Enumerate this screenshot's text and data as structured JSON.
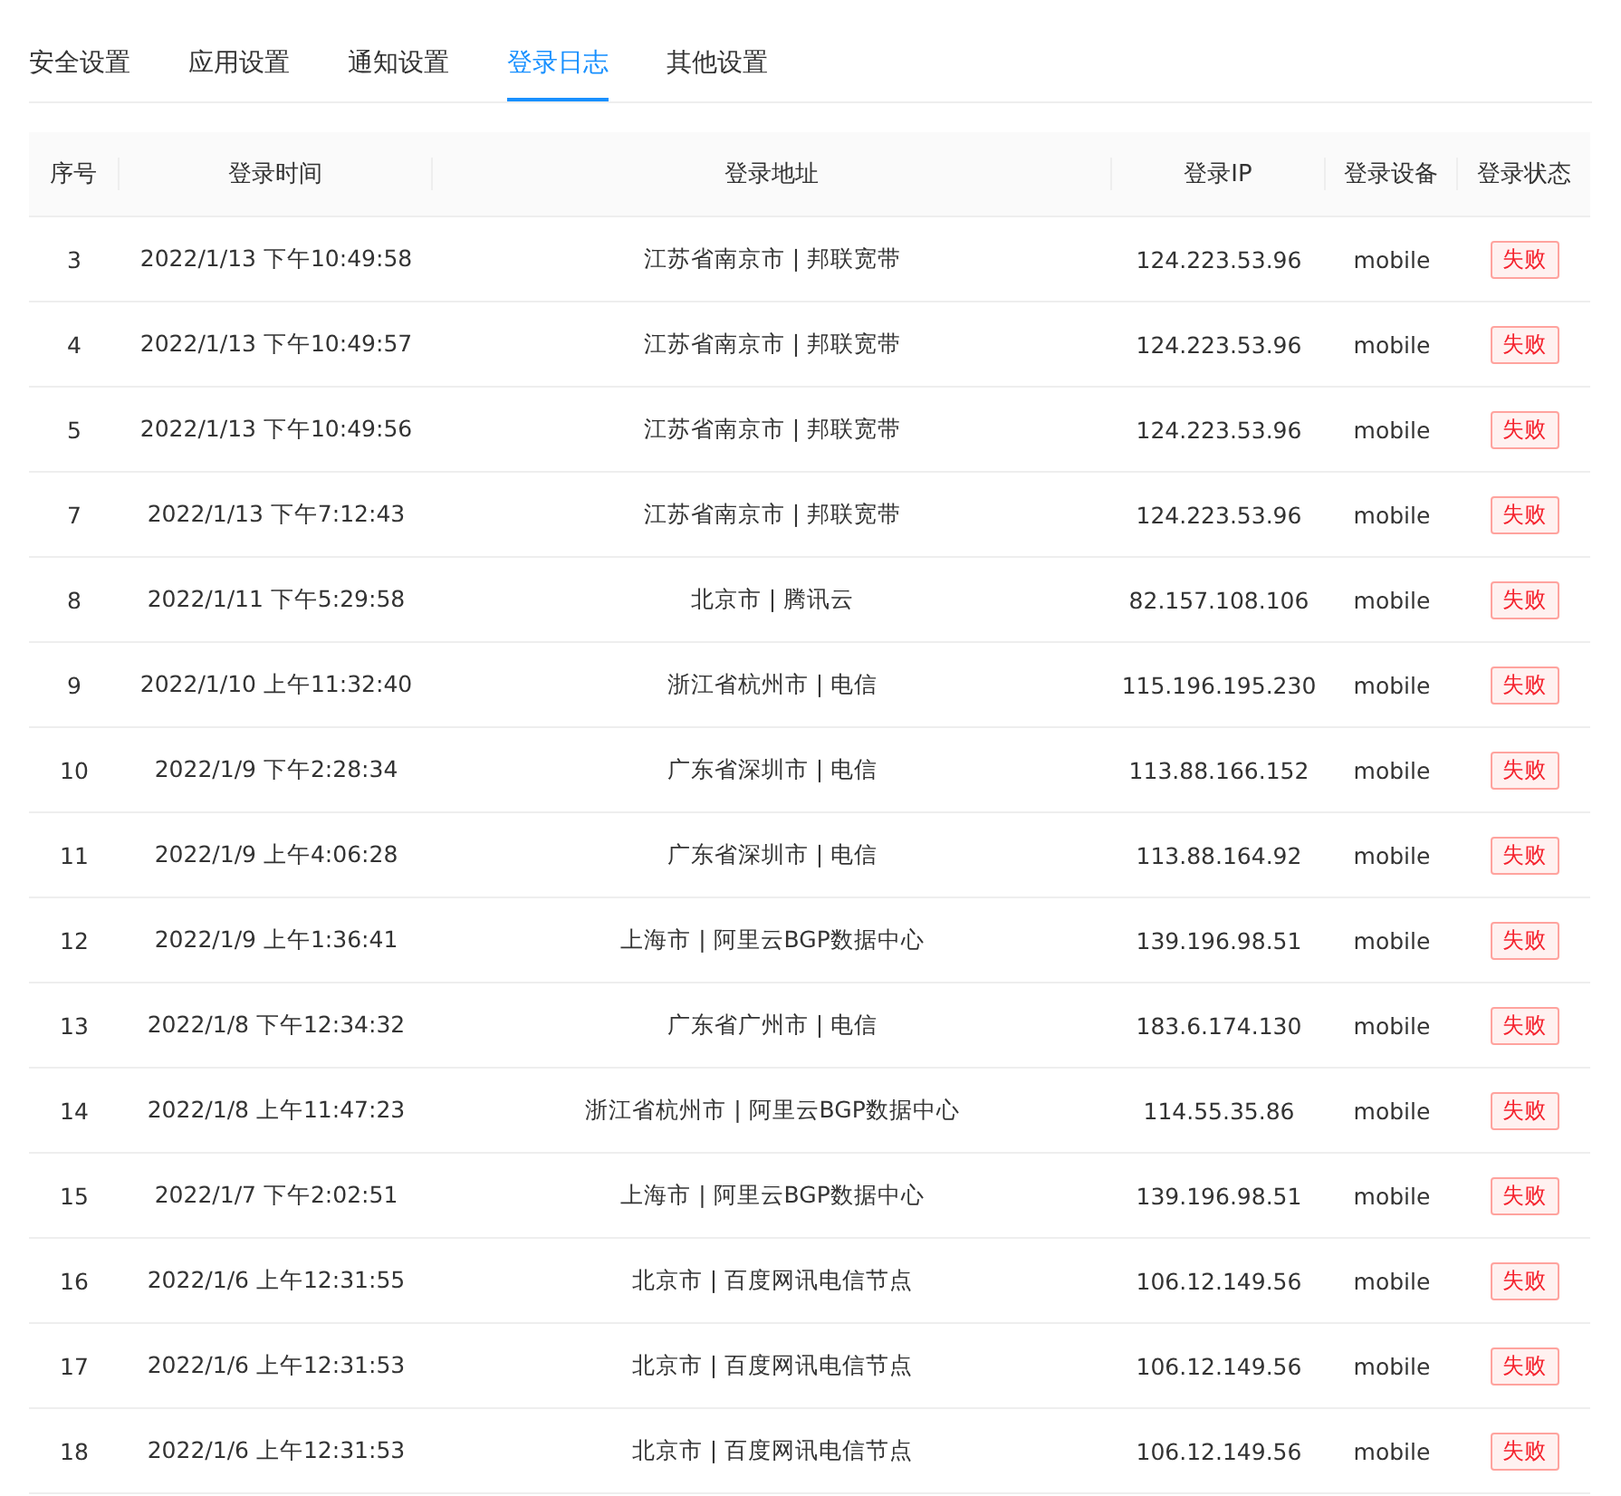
{
  "tabs": [
    {
      "label": "安全设置",
      "selected": false
    },
    {
      "label": "应用设置",
      "selected": false
    },
    {
      "label": "通知设置",
      "selected": false
    },
    {
      "label": "登录日志",
      "selected": true
    },
    {
      "label": "其他设置",
      "selected": false
    }
  ],
  "table": {
    "columns": [
      "序号",
      "登录时间",
      "登录地址",
      "登录IP",
      "登录设备",
      "登录状态"
    ],
    "rows": [
      {
        "index": "3",
        "time": "2022/1/13 下午10:49:58",
        "address": "江苏省南京市 | 邦联宽带",
        "ip": "124.223.53.96",
        "device": "mobile",
        "status": {
          "text": "失败",
          "kind": "error"
        }
      },
      {
        "index": "4",
        "time": "2022/1/13 下午10:49:57",
        "address": "江苏省南京市 | 邦联宽带",
        "ip": "124.223.53.96",
        "device": "mobile",
        "status": {
          "text": "失败",
          "kind": "error"
        }
      },
      {
        "index": "5",
        "time": "2022/1/13 下午10:49:56",
        "address": "江苏省南京市 | 邦联宽带",
        "ip": "124.223.53.96",
        "device": "mobile",
        "status": {
          "text": "失败",
          "kind": "error"
        }
      },
      {
        "index": "7",
        "time": "2022/1/13 下午7:12:43",
        "address": "江苏省南京市 | 邦联宽带",
        "ip": "124.223.53.96",
        "device": "mobile",
        "status": {
          "text": "失败",
          "kind": "error"
        }
      },
      {
        "index": "8",
        "time": "2022/1/11 下午5:29:58",
        "address": "北京市 | 腾讯云",
        "ip": "82.157.108.106",
        "device": "mobile",
        "status": {
          "text": "失败",
          "kind": "error"
        }
      },
      {
        "index": "9",
        "time": "2022/1/10 上午11:32:40",
        "address": "浙江省杭州市 | 电信",
        "ip": "115.196.195.230",
        "device": "mobile",
        "status": {
          "text": "失败",
          "kind": "error"
        }
      },
      {
        "index": "10",
        "time": "2022/1/9 下午2:28:34",
        "address": "广东省深圳市 | 电信",
        "ip": "113.88.166.152",
        "device": "mobile",
        "status": {
          "text": "失败",
          "kind": "error"
        }
      },
      {
        "index": "11",
        "time": "2022/1/9 上午4:06:28",
        "address": "广东省深圳市 | 电信",
        "ip": "113.88.164.92",
        "device": "mobile",
        "status": {
          "text": "失败",
          "kind": "error"
        }
      },
      {
        "index": "12",
        "time": "2022/1/9 上午1:36:41",
        "address": "上海市 | 阿里云BGP数据中心",
        "ip": "139.196.98.51",
        "device": "mobile",
        "status": {
          "text": "失败",
          "kind": "error"
        }
      },
      {
        "index": "13",
        "time": "2022/1/8 下午12:34:32",
        "address": "广东省广州市 | 电信",
        "ip": "183.6.174.130",
        "device": "mobile",
        "status": {
          "text": "失败",
          "kind": "error"
        }
      },
      {
        "index": "14",
        "time": "2022/1/8 上午11:47:23",
        "address": "浙江省杭州市 | 阿里云BGP数据中心",
        "ip": "114.55.35.86",
        "device": "mobile",
        "status": {
          "text": "失败",
          "kind": "error"
        }
      },
      {
        "index": "15",
        "time": "2022/1/7 下午2:02:51",
        "address": "上海市 | 阿里云BGP数据中心",
        "ip": "139.196.98.51",
        "device": "mobile",
        "status": {
          "text": "失败",
          "kind": "error"
        }
      },
      {
        "index": "16",
        "time": "2022/1/6 上午12:31:55",
        "address": "北京市 | 百度网讯电信节点",
        "ip": "106.12.149.56",
        "device": "mobile",
        "status": {
          "text": "失败",
          "kind": "error"
        }
      },
      {
        "index": "17",
        "time": "2022/1/6 上午12:31:53",
        "address": "北京市 | 百度网讯电信节点",
        "ip": "106.12.149.56",
        "device": "mobile",
        "status": {
          "text": "失败",
          "kind": "error"
        }
      },
      {
        "index": "18",
        "time": "2022/1/6 上午12:31:53",
        "address": "北京市 | 百度网讯电信节点",
        "ip": "106.12.149.56",
        "device": "mobile",
        "status": {
          "text": "失败",
          "kind": "error"
        }
      }
    ]
  }
}
